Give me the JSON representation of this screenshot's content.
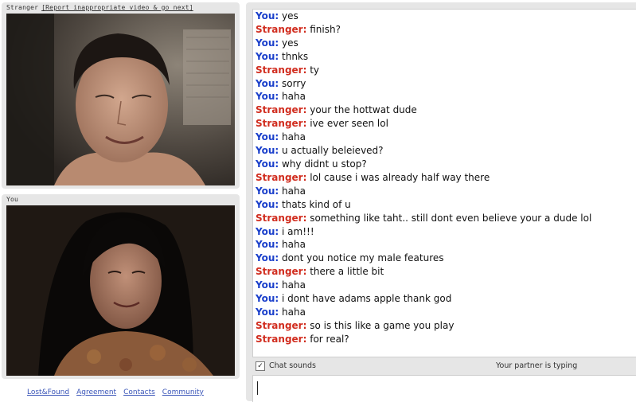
{
  "stranger_panel": {
    "label": "Stranger",
    "report_link": "[Report inappropriate video & go next]"
  },
  "you_panel": {
    "label": "You"
  },
  "footer": {
    "links": [
      "Lost&Found",
      "Agreement",
      "Contacts",
      "Community"
    ]
  },
  "chat": {
    "messages": [
      {
        "who": "You:",
        "text": "yes"
      },
      {
        "who": "Stranger:",
        "text": "finish?"
      },
      {
        "who": "You:",
        "text": "yes"
      },
      {
        "who": "You:",
        "text": "thnks"
      },
      {
        "who": "Stranger:",
        "text": "ty"
      },
      {
        "who": "You:",
        "text": "sorry"
      },
      {
        "who": "You:",
        "text": "haha"
      },
      {
        "who": "Stranger:",
        "text": "your the hottwat dude"
      },
      {
        "who": "Stranger:",
        "text": "ive ever seen lol"
      },
      {
        "who": "You:",
        "text": "haha"
      },
      {
        "who": "You:",
        "text": "u actually beleieved?"
      },
      {
        "who": "You:",
        "text": "why didnt u stop?"
      },
      {
        "who": "Stranger:",
        "text": "lol cause i was already half way there"
      },
      {
        "who": "You:",
        "text": "haha"
      },
      {
        "who": "You:",
        "text": "thats kind of u"
      },
      {
        "who": "Stranger:",
        "text": "something like taht.. still dont even believe your a dude lol"
      },
      {
        "who": "You:",
        "text": "i am!!!"
      },
      {
        "who": "You:",
        "text": "haha"
      },
      {
        "who": "You:",
        "text": "dont you notice my male features"
      },
      {
        "who": "Stranger:",
        "text": "there a little bit"
      },
      {
        "who": "You:",
        "text": "haha"
      },
      {
        "who": "You:",
        "text": "i dont have adams apple thank god"
      },
      {
        "who": "You:",
        "text": "haha"
      },
      {
        "who": "Stranger:",
        "text": "so is this like a game you play"
      },
      {
        "who": "Stranger:",
        "text": "for real?"
      }
    ],
    "chat_sounds_label": "Chat sounds",
    "chat_sounds_checked": true,
    "typing_status": "Your partner is typing",
    "input_value": ""
  },
  "colors": {
    "you_label": "#1a3fcb",
    "stranger_label": "#d12d1f",
    "panel_bg": "#e6e6e6",
    "link": "#3a55b8"
  }
}
